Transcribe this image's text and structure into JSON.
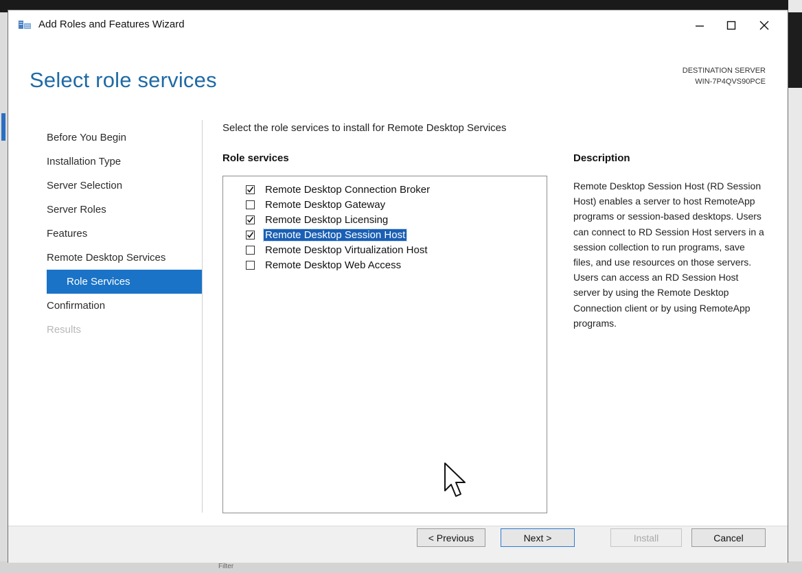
{
  "window": {
    "title": "Add Roles and Features Wizard",
    "controls": [
      "minimize",
      "maximize",
      "close"
    ]
  },
  "header": {
    "page_title": "Select role services",
    "destination_label": "DESTINATION SERVER",
    "destination_server": "WIN-7P4QVS90PCE"
  },
  "nav": {
    "items": [
      {
        "label": "Before You Begin",
        "state": "normal"
      },
      {
        "label": "Installation Type",
        "state": "normal"
      },
      {
        "label": "Server Selection",
        "state": "normal"
      },
      {
        "label": "Server Roles",
        "state": "normal"
      },
      {
        "label": "Features",
        "state": "normal"
      },
      {
        "label": "Remote Desktop Services",
        "state": "normal"
      },
      {
        "label": "Role Services",
        "state": "active"
      },
      {
        "label": "Confirmation",
        "state": "normal"
      },
      {
        "label": "Results",
        "state": "disabled"
      }
    ]
  },
  "main": {
    "instruction": "Select the role services to install for Remote Desktop Services",
    "role_services_header": "Role services",
    "role_services": [
      {
        "label": "Remote Desktop Connection Broker",
        "checked": true,
        "selected": false
      },
      {
        "label": "Remote Desktop Gateway",
        "checked": false,
        "selected": false
      },
      {
        "label": "Remote Desktop Licensing",
        "checked": true,
        "selected": false
      },
      {
        "label": "Remote Desktop Session Host",
        "checked": true,
        "selected": true
      },
      {
        "label": "Remote Desktop Virtualization Host",
        "checked": false,
        "selected": false
      },
      {
        "label": "Remote Desktop Web Access",
        "checked": false,
        "selected": false
      }
    ],
    "description_header": "Description",
    "description_text": "Remote Desktop Session Host (RD Session Host) enables a server to host RemoteApp programs or session-based desktops. Users can connect to RD Session Host servers in a session collection to run programs, save files, and use resources on those servers. Users can access an RD Session Host server by using the Remote Desktop Connection client or by using RemoteApp programs."
  },
  "footer": {
    "previous_label": "< Previous",
    "next_label": "Next >",
    "install_label": "Install",
    "cancel_label": "Cancel"
  },
  "background": {
    "taskbar_text": "Filter"
  },
  "colors": {
    "title_blue": "#1f6aa5",
    "selection_blue": "#1a73c6",
    "highlight_blue": "#1a5fb4"
  }
}
